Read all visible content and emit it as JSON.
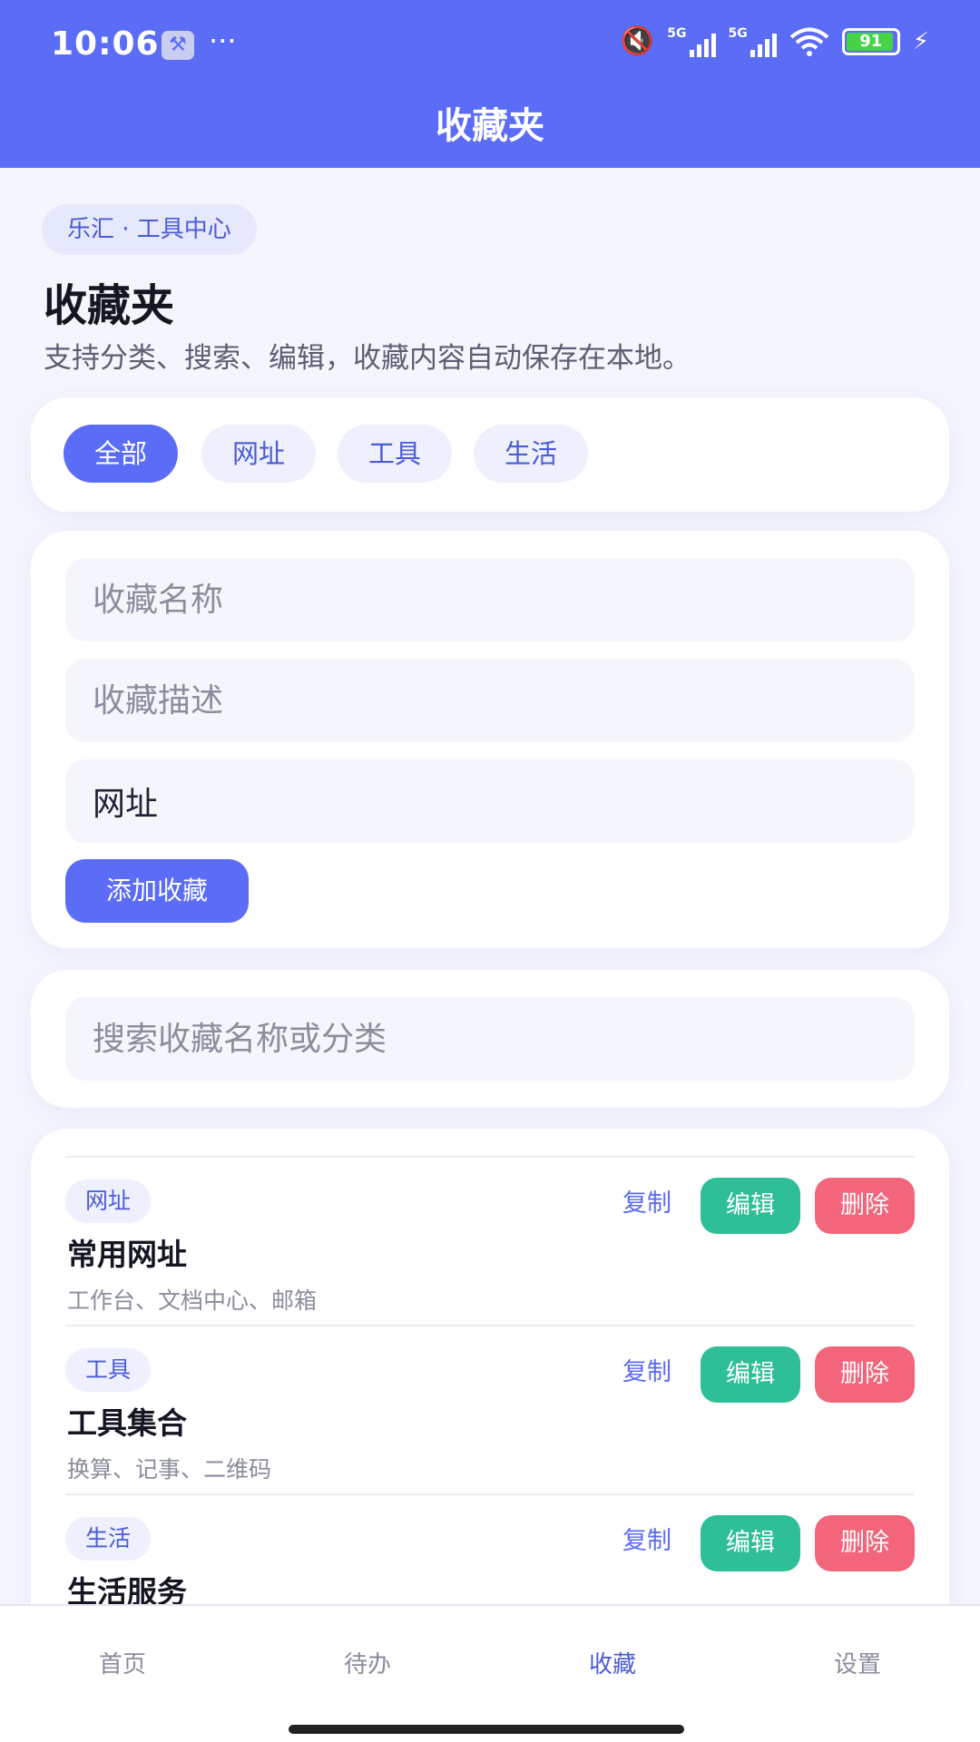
{
  "status_bar": {
    "time": "10:06",
    "network_1": "5G",
    "network_2": "5G",
    "battery": "91"
  },
  "header": {
    "title": "收藏夹"
  },
  "intro": {
    "tag": "乐汇 · 工具中心",
    "heading": "收藏夹",
    "description": "支持分类、搜索、编辑，收藏内容自动保存在本地。"
  },
  "filters": {
    "selected": "全部",
    "items": [
      "全部",
      "网址",
      "工具",
      "生活"
    ]
  },
  "form": {
    "name_placeholder": "收藏名称",
    "desc_placeholder": "收藏描述",
    "category_value": "网址",
    "add_label": "添加收藏"
  },
  "search": {
    "placeholder": "搜索收藏名称或分类"
  },
  "list": [
    {
      "category": "网址",
      "name": "常用网址",
      "desc": "工作台、文档中心、邮箱",
      "copy": "复制",
      "edit": "编辑",
      "delete": "删除"
    },
    {
      "category": "工具",
      "name": "工具集合",
      "desc": "换算、记事、二维码",
      "copy": "复制",
      "edit": "编辑",
      "delete": "删除"
    },
    {
      "category": "生活",
      "name": "生活服务",
      "desc": "",
      "copy": "复制",
      "edit": "编辑",
      "delete": "删除"
    }
  ],
  "tabs": [
    {
      "label": "首页",
      "active": false
    },
    {
      "label": "待办",
      "active": false
    },
    {
      "label": "收藏",
      "active": true
    },
    {
      "label": "设置",
      "active": false
    }
  ],
  "colors": {
    "primary": "#5b6cf6",
    "edit": "#2ebf97",
    "delete": "#f2657a"
  }
}
